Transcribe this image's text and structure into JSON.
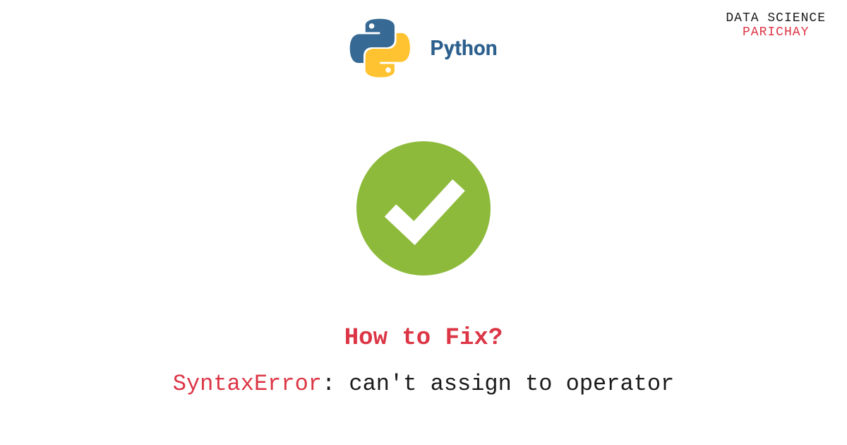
{
  "brand": {
    "line1": "DATA SCIENCE",
    "line2": "PARICHAY"
  },
  "header": {
    "python_label": "Python"
  },
  "heading": "How to Fix?",
  "error": {
    "name": "SyntaxError",
    "message": ": can't assign to operator"
  },
  "colors": {
    "accent_red": "#dc3545",
    "python_blue": "#366994",
    "python_yellow": "#ffc331",
    "check_green": "#8dba3b",
    "label_blue": "#2c5f8d"
  }
}
